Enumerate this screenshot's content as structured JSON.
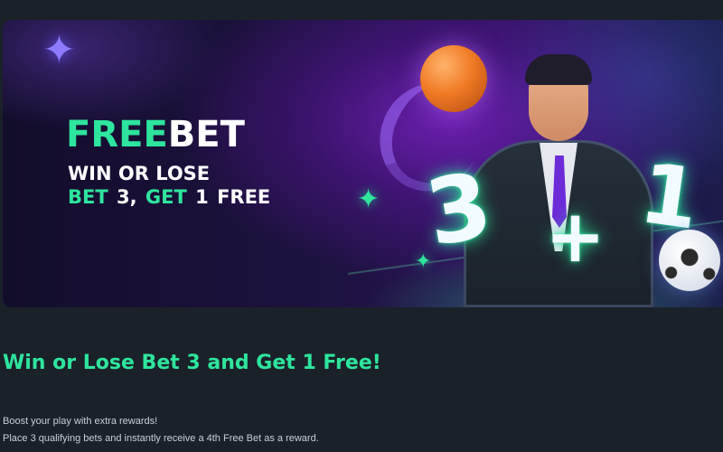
{
  "banner": {
    "logo_free": "FREE",
    "logo_bet": "BET",
    "tagline_line1": "WIN OR LOSE",
    "tagline_bet_word": "BET",
    "tagline_bet_number": "3,",
    "tagline_get_word": "GET",
    "tagline_get_rest": "1 FREE",
    "graphic_three": "3",
    "graphic_plus": "+",
    "graphic_one": "1",
    "icons": [
      "sparkle-icon",
      "basketball-icon",
      "soccer-ball-icon"
    ],
    "colors": {
      "accent_green": "#2ee59d",
      "background_purple": "#1d1240",
      "page_background": "#1a2129"
    }
  },
  "content": {
    "headline": "Win or Lose Bet 3 and Get 1 Free!",
    "paragraph1": "Boost your play with extra rewards!",
    "paragraph2": "Place 3 qualifying bets and instantly receive a 4th Free Bet as a reward."
  }
}
